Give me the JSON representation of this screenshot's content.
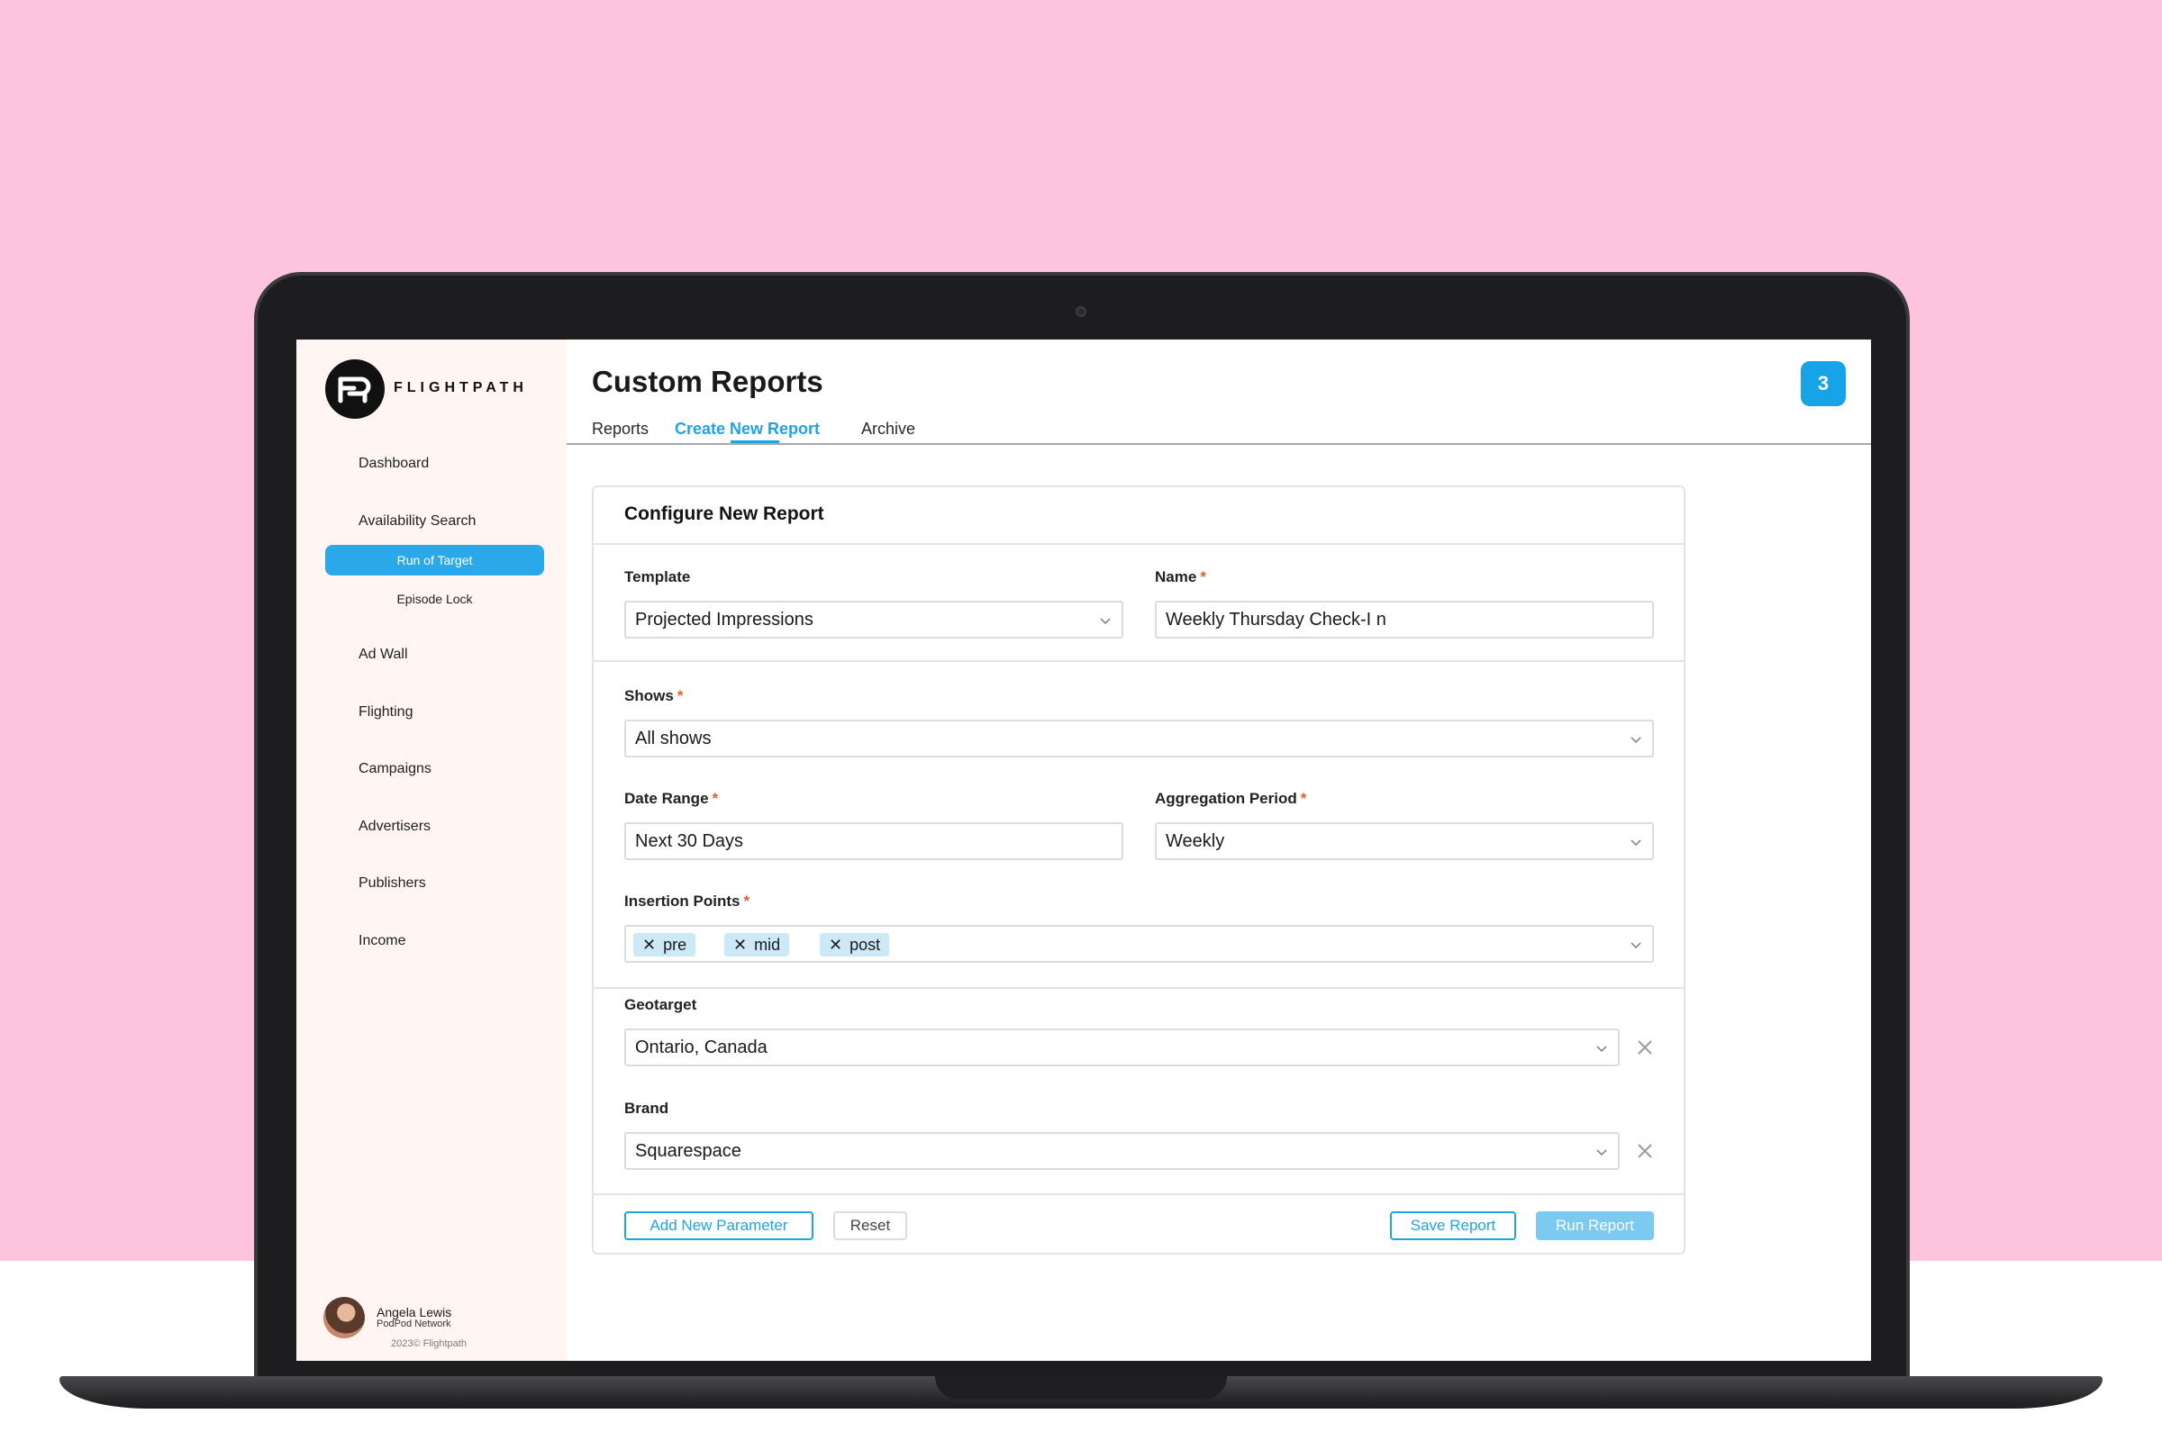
{
  "app": {
    "brand": "FLIGHTPATH",
    "notification_count": "3"
  },
  "sidebar": {
    "items": [
      {
        "label": "Dashboard"
      },
      {
        "label": "Availability Search"
      },
      {
        "label": "Run of Target",
        "active": true
      },
      {
        "label": "Episode Lock"
      },
      {
        "label": "Ad Wall"
      },
      {
        "label": "Flighting"
      },
      {
        "label": "Campaigns"
      },
      {
        "label": "Advertisers"
      },
      {
        "label": "Publishers"
      },
      {
        "label": "Income"
      }
    ],
    "user": {
      "name": "Angela Lewis",
      "org": "PodPod Network"
    },
    "copyright": "2023© Flightpath"
  },
  "header": {
    "title": "Custom Reports",
    "tabs": [
      {
        "label": "Reports"
      },
      {
        "label": "Create New Report",
        "active": true
      },
      {
        "label": "Archive"
      }
    ]
  },
  "form": {
    "title": "Configure New Report",
    "template": {
      "label": "Template",
      "value": "Projected Impressions"
    },
    "name": {
      "label": "Name",
      "value": "Weekly Thursday Check-I n"
    },
    "shows": {
      "label": "Shows",
      "value": "All shows"
    },
    "date_range": {
      "label": "Date Range",
      "value": "Next 30 Days"
    },
    "aggregation": {
      "label": "Aggregation Period",
      "value": "Weekly"
    },
    "insertion_points": {
      "label": "Insertion Points",
      "chips": [
        "pre",
        "mid",
        "post"
      ]
    },
    "geotarget": {
      "label": "Geotarget",
      "value": "Ontario, Canada"
    },
    "brand": {
      "label": "Brand",
      "value": "Squarespace"
    },
    "required_mark": "*"
  },
  "actions": {
    "add_parameter": "Add New Parameter",
    "reset": "Reset",
    "save": "Save Report",
    "run": "Run Report"
  },
  "colors": {
    "accent": "#1fa3e4",
    "background": "#fec4dd",
    "sidebar": "#fff6f3",
    "chip": "#cde9f7",
    "required": "#e2622a"
  }
}
